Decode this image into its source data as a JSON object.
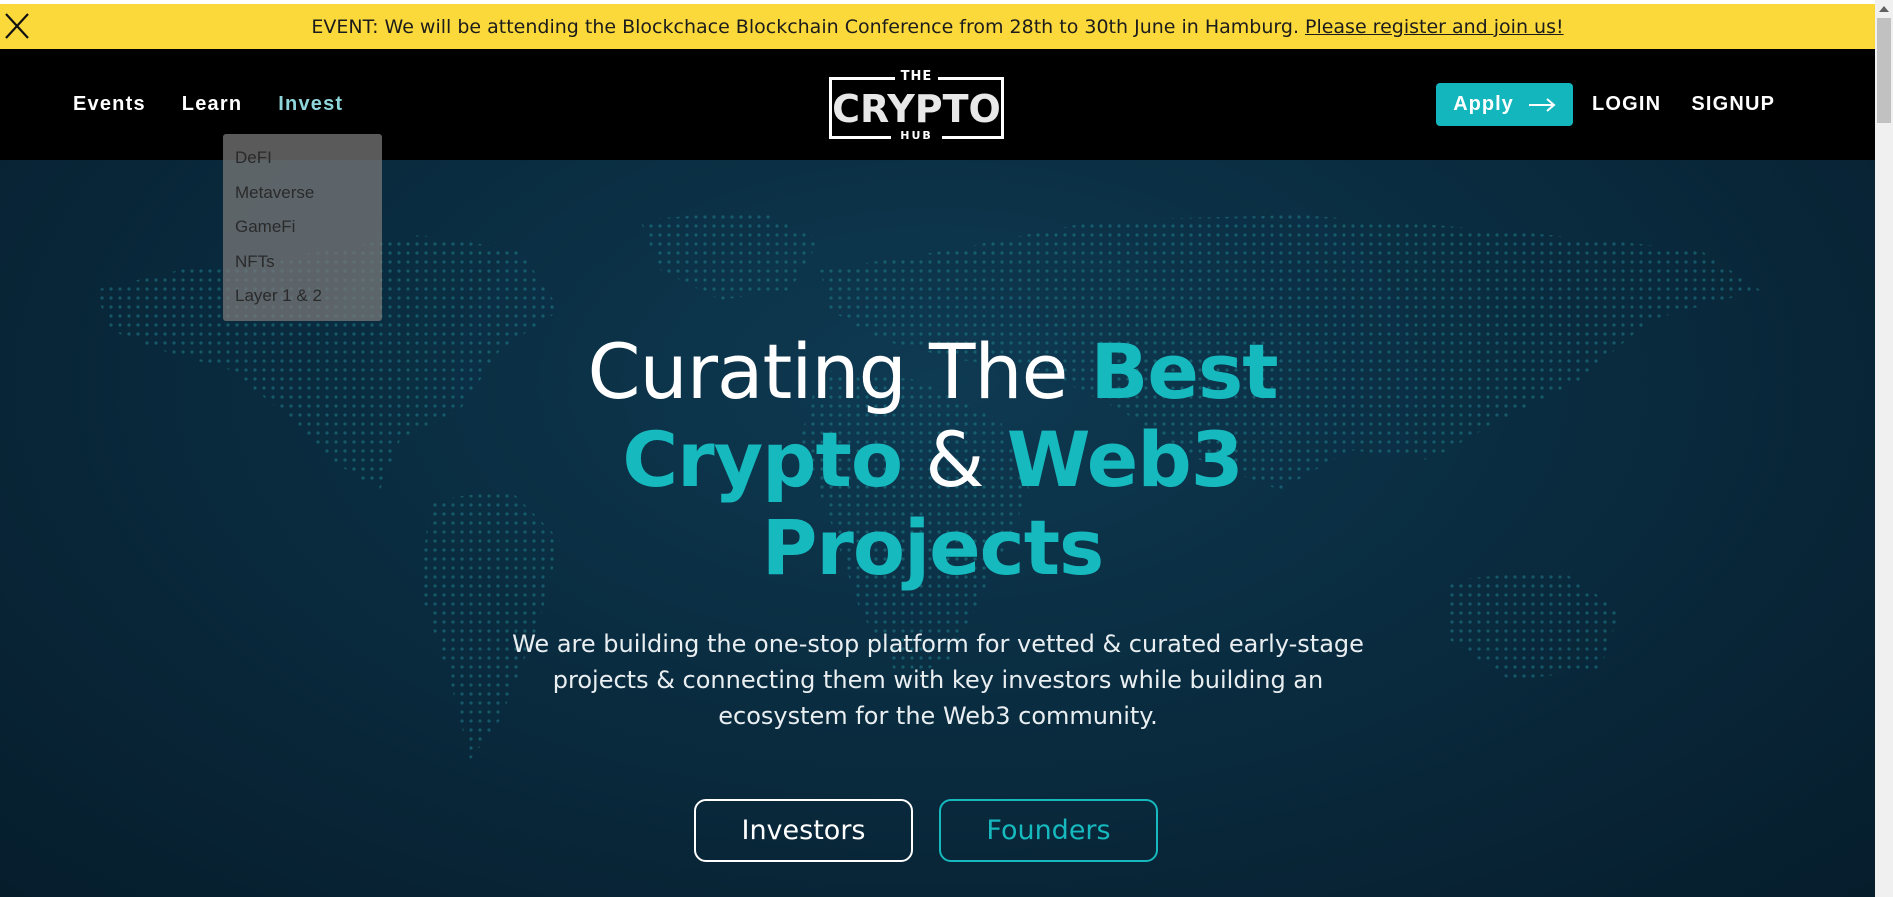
{
  "banner": {
    "close_label": "X",
    "event_label": "EVENT:",
    "event_text": "We will be attending the Blockchace Blockchain Conference from 28th to 30th June in Hamburg.",
    "link_text": "Please register and join us!"
  },
  "nav": {
    "events": "Events",
    "learn": "Learn",
    "invest": "Invest",
    "login": "LOGIN",
    "signup": "SIGNUP",
    "apply": "Apply"
  },
  "logo": {
    "the": "THE",
    "name": "CRYPTO",
    "hub": "HUB"
  },
  "dropdown": {
    "items": [
      "DeFI",
      "Metaverse",
      "GameFi",
      "NFTs",
      "Layer 1 & 2"
    ]
  },
  "hero": {
    "title_part1": "Curating The ",
    "title_best": "Best",
    "title_crypto": "Crypto",
    "title_amp": " & ",
    "title_web3": "Web3",
    "title_projects": "Projects",
    "subtitle": "We are building the one-stop platform for vetted & curated early-stage projects & connecting them with key investors while building an ecosystem for the Web3 community.",
    "btn_investors": "Investors",
    "btn_founders": "Founders"
  },
  "colors": {
    "banner": "#fcd93a",
    "accent": "#16b9be",
    "header": "#000000",
    "hero_bg": "#0a2c40"
  },
  "icons": {
    "close": "close-icon",
    "apply_arrow": "arrow-right-icon",
    "scroll_up": "scroll-up-icon"
  }
}
